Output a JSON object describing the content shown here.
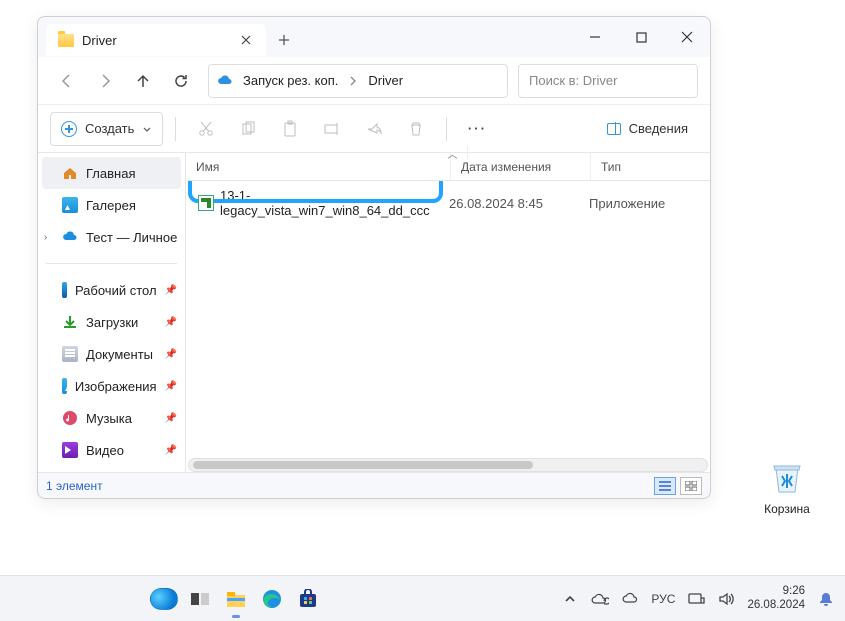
{
  "window": {
    "tab_title": "Driver",
    "breadcrumb": {
      "root": "Запуск рез. коп.",
      "current": "Driver"
    },
    "search_placeholder": "Поиск в: Driver",
    "create_label": "Создать",
    "details_label": "Сведения",
    "columns": {
      "name": "Имя",
      "date": "Дата изменения",
      "type": "Тип"
    },
    "sidebar": {
      "home": "Главная",
      "gallery": "Галерея",
      "onedrive": "Тест — Личное",
      "desktop": "Рабочий стол",
      "downloads": "Загрузки",
      "documents": "Документы",
      "pictures": "Изображения",
      "music": "Музыка",
      "videos": "Видео"
    },
    "files": [
      {
        "name": "13-1-legacy_vista_win7_win8_64_dd_ccc",
        "date": "26.08.2024 8:45",
        "type": "Приложение"
      }
    ],
    "status": "1 элемент"
  },
  "desktop": {
    "recycle_bin": "Корзина"
  },
  "taskbar": {
    "lang": "РУС",
    "time": "9:26",
    "date": "26.08.2024"
  }
}
